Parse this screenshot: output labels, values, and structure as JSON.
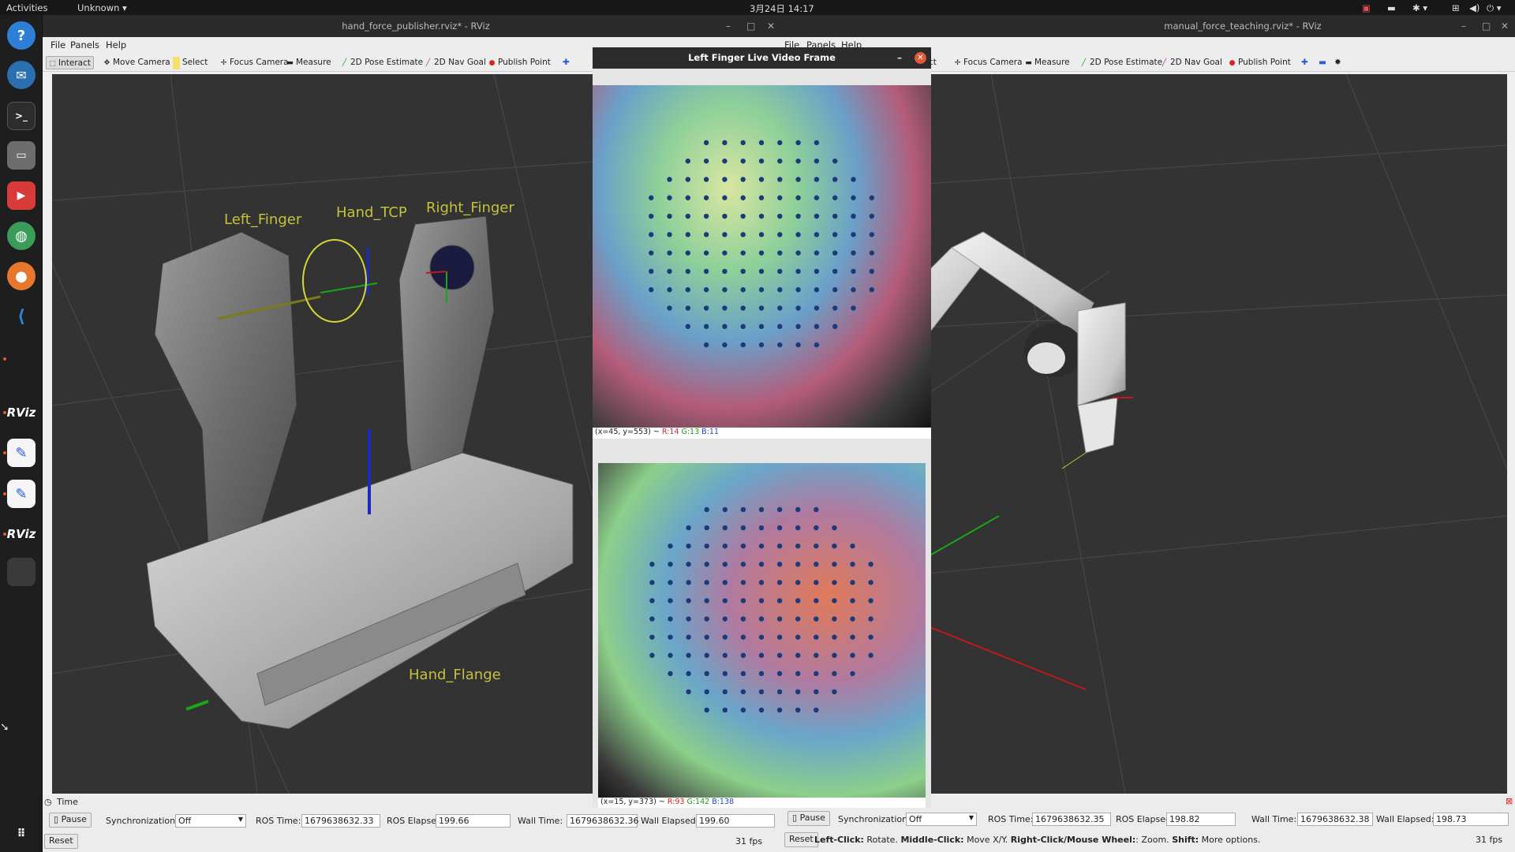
{
  "topbar": {
    "activities": "Activities",
    "app_menu": "Unknown ▾",
    "clock": "3月24日 14:17"
  },
  "dock": {
    "items": [
      {
        "name": "help",
        "glyph": "?",
        "color": "#2e7fd6"
      },
      {
        "name": "thunderbird",
        "glyph": "✉",
        "color": "#2a6fb0"
      },
      {
        "name": "terminal",
        "glyph": ">_",
        "color": "#2d2d2d"
      },
      {
        "name": "files",
        "glyph": "▭",
        "color": "#6d6d6d"
      },
      {
        "name": "pdf-viewer",
        "glyph": "▶",
        "color": "#d93b3b"
      },
      {
        "name": "browser-green",
        "glyph": "◍",
        "color": "#3b9c5a"
      },
      {
        "name": "firefox",
        "glyph": "●",
        "color": "#e8772e"
      },
      {
        "name": "vscode",
        "glyph": "◀",
        "color": "#2a87d9"
      },
      {
        "name": "rviz-1",
        "glyph": "RViz",
        "color": "#1e1e1e"
      },
      {
        "name": "text-editor-1",
        "glyph": "✎",
        "color": "#f5f5f5"
      },
      {
        "name": "text-editor-2",
        "glyph": "✎",
        "color": "#f5f5f5"
      },
      {
        "name": "rviz-2",
        "glyph": "RViz",
        "color": "#1e1e1e"
      },
      {
        "name": "app-grid",
        "glyph": "⋮⋮⋮",
        "color": "#1e1e1e"
      }
    ]
  },
  "left_window": {
    "title": "hand_force_publisher.rviz* - RViz",
    "menu": [
      "File",
      "Panels",
      "Help"
    ],
    "tools": [
      "Interact",
      "Move Camera",
      "Select",
      "Focus Camera",
      "Measure",
      "2D Pose Estimate",
      "2D Nav Goal",
      "Publish Point"
    ],
    "frame_labels": {
      "left_finger": "Left_Finger",
      "hand_tcp": "Hand_TCP",
      "right_finger": "Right_Finger",
      "hand_flange": "Hand_Flange"
    },
    "time_panel": {
      "header": "Time",
      "pause": "Pause",
      "sync_label": "Synchronization:",
      "sync_value": "Off",
      "ros_time_label": "ROS Time:",
      "ros_time": "1679638632.33",
      "ros_elapsed_label": "ROS Elapsed:",
      "ros_elapsed": "199.66",
      "wall_time_label": "Wall Time:",
      "wall_time": "1679638632.36",
      "wall_elapsed_label": "Wall Elapsed:",
      "wall_elapsed": "199.60",
      "reset": "Reset",
      "fps": "31 fps"
    }
  },
  "right_window": {
    "title": "manual_force_teaching.rviz* - RViz",
    "menu": [
      "File",
      "Panels",
      "Help"
    ],
    "tools": [
      "ct",
      "Focus Camera",
      "Measure",
      "2D Pose Estimate",
      "2D Nav Goal",
      "Publish Point"
    ],
    "time_panel": {
      "pause": "Pause",
      "sync_label": "Synchronization:",
      "sync_value": "Off",
      "ros_time_label": "ROS Time:",
      "ros_time": "1679638632.35",
      "ros_elapsed_label": "ROS Elapsed:",
      "ros_elapsed": "198.82",
      "wall_time_label": "Wall Time:",
      "wall_time": "1679638632.38",
      "wall_elapsed_label": "Wall Elapsed:",
      "wall_elapsed": "198.73",
      "reset": "Reset",
      "fps": "31 fps",
      "hint_left_click": "Left-Click:",
      "hint_left_action": " Rotate. ",
      "hint_middle_click": "Middle-Click:",
      "hint_middle_action": " Move X/Y. ",
      "hint_right_click": "Right-Click/Mouse Wheel:",
      "hint_right_action": ": Zoom. ",
      "hint_shift": "Shift:",
      "hint_shift_action": " More options."
    }
  },
  "video_window": {
    "title": "Left Finger Live Video Frame",
    "top_status": {
      "coords": "(x=45, y=553) ~ ",
      "r": "R:14",
      "g": "G:13",
      "b": "B:11"
    },
    "bottom_status": {
      "coords": "(x=15, y=373) ~ ",
      "r": "R:93",
      "g": "G:142",
      "b": "B:138"
    }
  },
  "colors": {
    "axis_red": "#c0181b",
    "axis_green": "#1aa51a",
    "axis_blue": "#1b2bc2",
    "label_yellow": "#c5c23a"
  }
}
